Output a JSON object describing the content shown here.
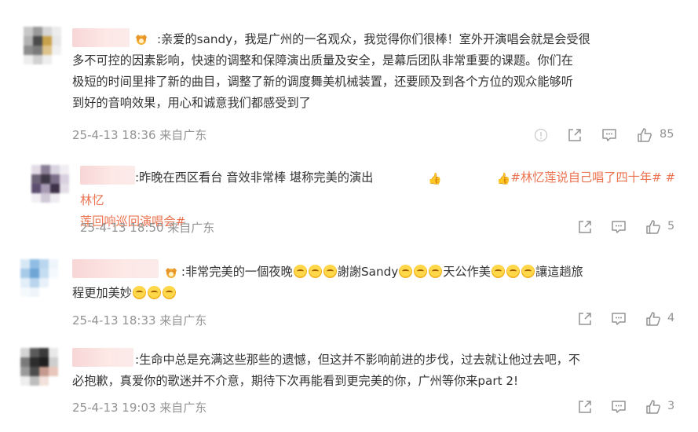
{
  "comments": [
    {
      "text_lines": [
        ":亲爱的sandy，我是广州的一名观众，我觉得你们很棒！室外开演唱会就是会受很",
        "多不可控的因素影响，快速的调整和保障演出质量及安全，是幕后团队非常重要的课题。你们在",
        "极短的时间里排了新的曲目，调整了新的调度舞美机械装置，还要顾及到各个方位的观众能够听",
        "到好的音响效果，用心和诚意我们都感受到了"
      ],
      "meta": "25-4-13 18:36 来自广东",
      "likes": "85",
      "has_report": true,
      "badge": "crown-badge",
      "avatar_colors": [
        "#c8c8c8",
        "#9a9a9a",
        "#d6d6d6",
        "#ececec",
        "#b3b3b3",
        "#4a4a4a",
        "#c9a24c",
        "#e7e7e7",
        "#8d8d8d",
        "#7a7a7a",
        "#ddc38a",
        "#f0f0f0",
        "#eeeeee",
        "#d1d1d1",
        "#eeeeee",
        "#ffffff"
      ]
    },
    {
      "text_prefix": ":昨晚在西区看台 音效非常棒 堪称完美的演出",
      "emoji_1": "👍",
      "emoji_2": "👍",
      "hashtag_1": "#林忆莲说自己唱了四十年#",
      "hashtag_2a": " #林忆",
      "hashtag_2b": "莲回响巡回演唱会#",
      "meta": "25-4-13 18:50 来自广东",
      "likes": "5",
      "avatar_colors": [
        "#e2dbe6",
        "#8a7f96",
        "#d9d4e0",
        "#f1eef3",
        "#6e6478",
        "#3f3947",
        "#7c6f89",
        "#d8d0df",
        "#5d4f70",
        "#a79cb4",
        "#3e3248",
        "#e3dde8",
        "#f2eff4",
        "#cfc8d6",
        "#efecf1",
        "#ffffff"
      ]
    },
    {
      "text_a": " :非常完美的一個夜晚",
      "text_b": "謝謝Sandy",
      "text_c": "天公作美",
      "text_d": "讓這趟旅",
      "text_e": "程更加美妙",
      "meta": "25-4-13 18:33 来自广东",
      "likes": "4",
      "badge": "crown-badge",
      "avatar_colors": [
        "#d7e8f5",
        "#8fbde3",
        "#b9d6ee",
        "#eef5fb",
        "#a8cbe9",
        "#6ea5d6",
        "#c4ddf1",
        "#f4f9fd",
        "#e2eef8",
        "#bad5ec",
        "#e8f1f9",
        "#ffffff",
        "#f5f9fc",
        "#eef4fa",
        "#ffffff",
        "#ffffff"
      ]
    },
    {
      "text_lines": [
        ":生命中总是充满这些那些的遗憾，但这并不影响前进的步伐，过去就让他过去吧，不",
        "必抱歉，真爱你的歌迷并不介意，期待下次再能看到更完美的你，广州等你来part 2!"
      ],
      "meta": "25-4-13 19:03 来自广东",
      "likes": "3",
      "avatar_colors": [
        "#d3d3d3",
        "#5a5a5a",
        "#3a3a3a",
        "#e9e9e9",
        "#7a7a7a",
        "#2d2d2d",
        "#1f1f1f",
        "#cfcfcf",
        "#9a9a9a",
        "#4d4d4d",
        "#c49a8e",
        "#e8c6bc",
        "#eeeeee",
        "#bdbdbd",
        "#f2e1dc",
        "#ffffff"
      ]
    }
  ],
  "icons": {
    "report": "report-icon",
    "share": "share-icon",
    "comment": "comment-icon",
    "like": "like-icon"
  },
  "colors": {
    "text": "#333333",
    "meta": "#939393",
    "hashtag": "#eb7350",
    "nickname_blur": "#f7d6d6"
  }
}
